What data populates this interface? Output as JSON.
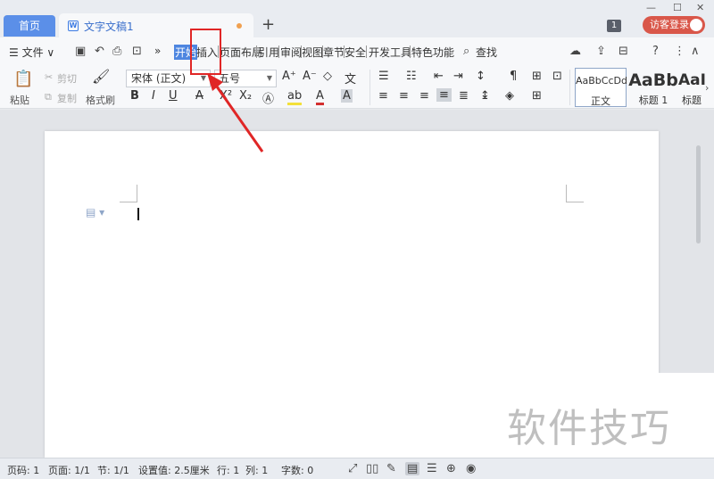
{
  "titlebar": {
    "home_tab": "首页",
    "doc_tab": "文字文稿1",
    "add_tab": "+",
    "badge": "1",
    "login": "访客登录",
    "win_min": "—",
    "win_max": "☐",
    "win_close": "✕"
  },
  "menubar": {
    "file": "☰ 文件 ∨",
    "more": "»",
    "items": [
      "开始",
      "插入",
      "页面布局",
      "引用",
      "审阅",
      "视图",
      "章节",
      "安全",
      "开发工具",
      "特色功能"
    ],
    "search": "查找",
    "right_icons": [
      "?",
      "⋮",
      "∧"
    ]
  },
  "ribbon": {
    "paste": "粘贴",
    "cut": "剪切",
    "copy": "复制",
    "format_painter": "格式刷",
    "font_name": "宋体 (正文)",
    "font_size": "五号",
    "bold": "B",
    "italic": "I",
    "underline": "U",
    "strike": "A",
    "superscript": "X²",
    "subscript": "X₂",
    "styles": [
      {
        "preview": "AaBbCcDd",
        "label": "正文"
      },
      {
        "preview": "AaBb",
        "label": "标题 1"
      },
      {
        "preview": "AaI",
        "label": "标题"
      }
    ]
  },
  "statusbar": {
    "page_num": "页码: 1",
    "pages": "页面: 1/1",
    "section": "节: 1/1",
    "setting": "设置值: 2.5厘米",
    "row": "行: 1",
    "col": "列: 1",
    "words": "字数: 0"
  },
  "watermark": "软件技巧",
  "colors": {
    "accent": "#4e86e0",
    "login": "#d9574a",
    "highlight": "#e02626"
  }
}
